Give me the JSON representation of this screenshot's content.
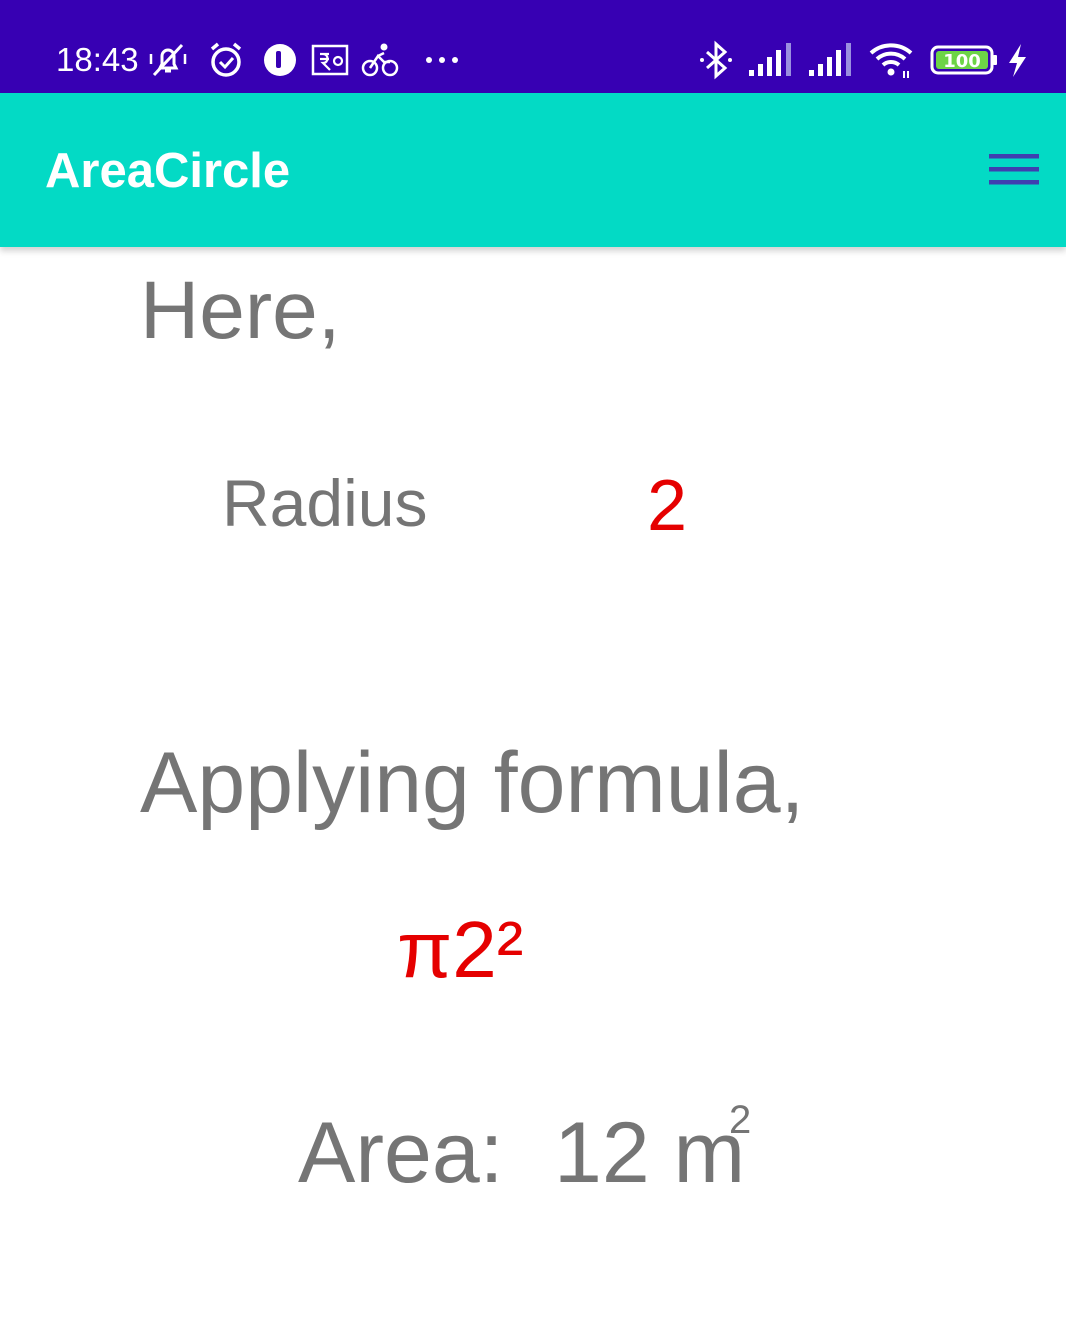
{
  "status_bar": {
    "time": "18:43",
    "background_color": "#3700b3",
    "left_icons": [
      "vibrate-silent-icon",
      "alarm-icon",
      "app-notification-icon",
      "rupee-icon",
      "cycling-icon",
      "more-dots-icon"
    ],
    "right_icons": [
      "bluetooth-icon",
      "signal-1-icon",
      "signal-2-icon",
      "wifi-icon",
      "battery-icon",
      "charging-icon"
    ],
    "battery_level": "100"
  },
  "app_bar": {
    "title": "AreaCircle",
    "background_color": "#03dac5",
    "menu_icon": "hamburger-menu-icon",
    "menu_icon_color": "#3f3fb0"
  },
  "content": {
    "intro": "Here,",
    "radius_label": "Radius",
    "radius_value": "2",
    "applying_text": "Applying formula,",
    "formula": "π2²",
    "area_label": "Area:",
    "area_value": "12 m",
    "area_unit_superscript": "2",
    "text_color": "#757575",
    "highlight_color": "#e50000"
  }
}
